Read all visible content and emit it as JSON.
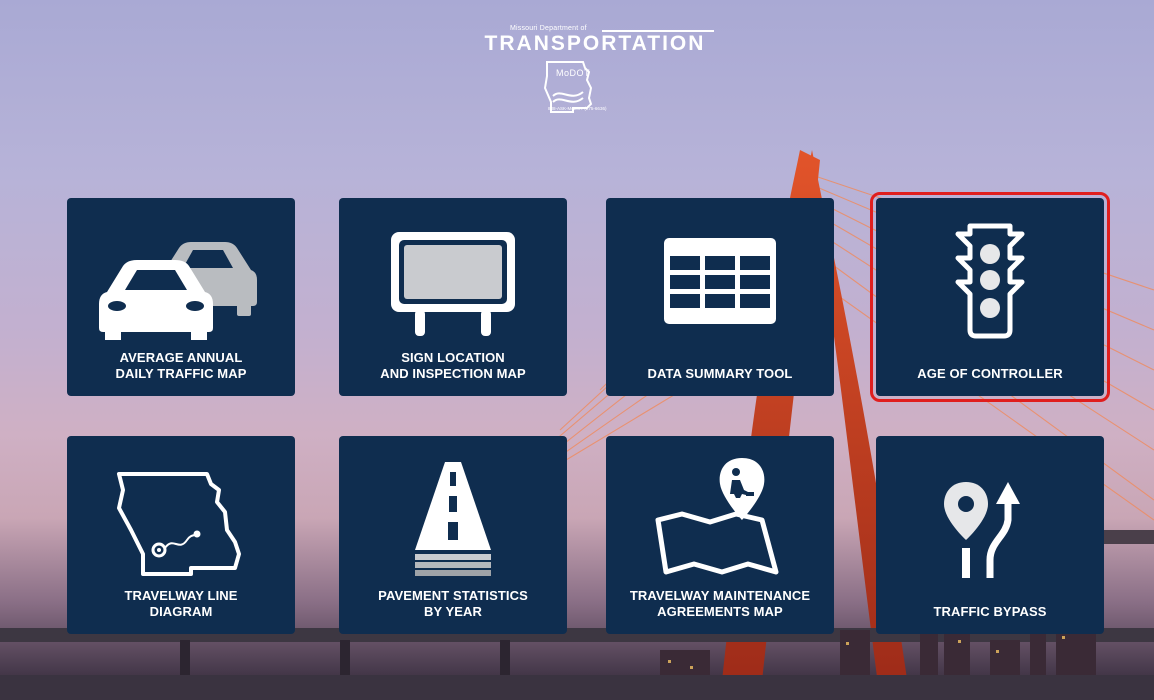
{
  "header": {
    "logo_top_line": "Missouri Department of",
    "logo_title": "TRANSPORTATION",
    "logo_mark": "MoDOT",
    "logo_phone": "888-ASK-MoDOT (275-6636)"
  },
  "tiles": [
    {
      "label": "AVERAGE ANNUAL\nDAILY TRAFFIC MAP",
      "icon": "cars-icon"
    },
    {
      "label": "SIGN LOCATION\nAND INSPECTION MAP",
      "icon": "sign-icon"
    },
    {
      "label": "DATA SUMMARY TOOL",
      "icon": "table-icon"
    },
    {
      "label": "AGE OF CONTROLLER",
      "icon": "traffic-light-icon",
      "selected": true
    },
    {
      "label": "TRAVELWAY LINE\nDIAGRAM",
      "icon": "missouri-map-icon"
    },
    {
      "label": "PAVEMENT STATISTICS\nBY YEAR",
      "icon": "road-icon"
    },
    {
      "label": "TRAVELWAY MAINTENANCE\nAGREEMENTS MAP",
      "icon": "map-worker-icon"
    },
    {
      "label": "TRAFFIC BYPASS",
      "icon": "bypass-icon"
    }
  ],
  "colors": {
    "tile": "#0f2d4f",
    "selection": "#e01e1e"
  }
}
